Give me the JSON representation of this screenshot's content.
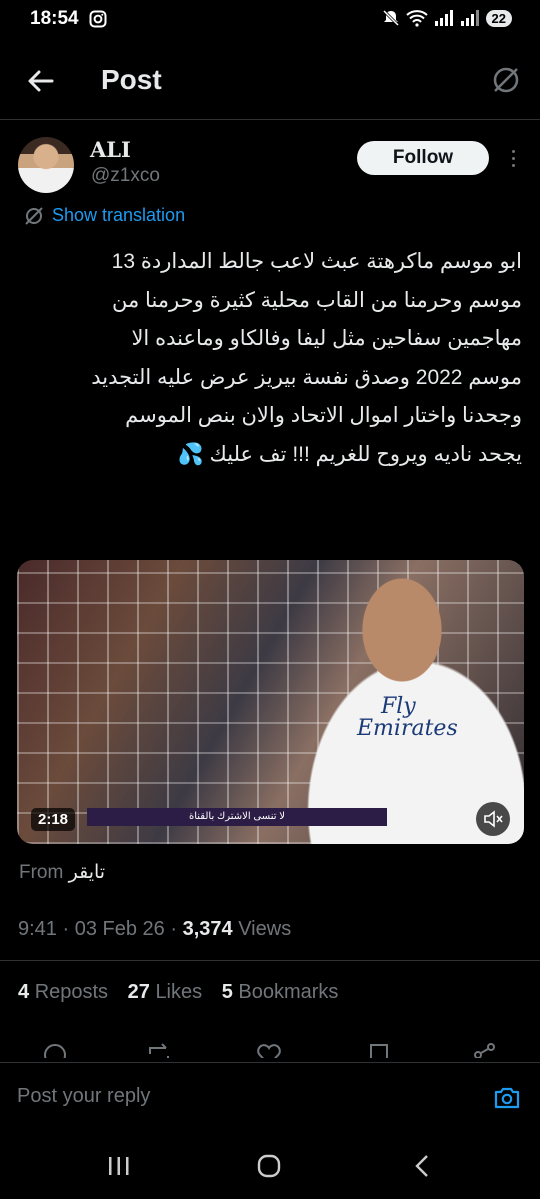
{
  "status_bar": {
    "time": "18:54",
    "battery": "22"
  },
  "header": {
    "title": "Post"
  },
  "author": {
    "name": "ALI",
    "handle": "@z1xco",
    "follow_label": "Follow"
  },
  "translate_label": "Show translation",
  "tweet_lines": [
    "ابو موسم ماكرهتة عبث لاعب جالط المداردة 13",
    "موسم وحرمنا من القاب محلية كثيرة وحرمنا من",
    "مهاجمين سفاحين مثل ليفا وفالكاو وماعنده الا",
    "موسم 2022 وصدق نفسة بيريز عرض عليه التجديد",
    "وجحدنا واختار اموال الاتحاد والان بنص الموسم",
    "يجحد ناديه ويروح للغريم !!! تف عليك 💦"
  ],
  "media": {
    "duration": "2:18",
    "banner_text": "لا تنسى الاشترك بالقناة",
    "kit_text_1": "Fly",
    "kit_text_2": "Emirates"
  },
  "from": {
    "label": "From",
    "source": "تايقر"
  },
  "meta": {
    "time": "9:41",
    "date": "03 Feb 26",
    "views_count": "3,374",
    "views_label": "Views"
  },
  "stats": {
    "reposts_count": "4",
    "reposts_label": "Reposts",
    "likes_count": "27",
    "likes_label": "Likes",
    "bookmarks_count": "5",
    "bookmarks_label": "Bookmarks"
  },
  "reply_placeholder": "Post your reply",
  "colors": {
    "accent": "#1d9bf0",
    "background": "#000000",
    "secondary_text": "#71767b"
  }
}
